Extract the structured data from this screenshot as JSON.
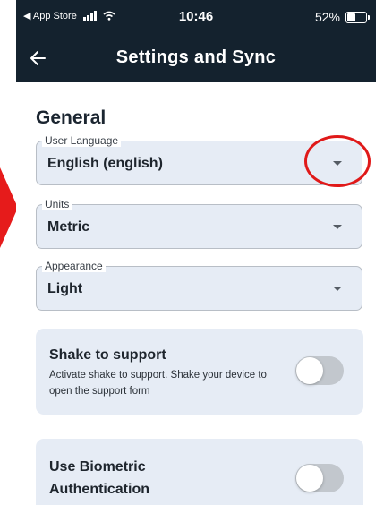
{
  "status_bar": {
    "back_app": "◀ App Store",
    "time": "10:46",
    "battery_percent": "52%",
    "battery_level": 0.52
  },
  "app_bar": {
    "title": "Settings and Sync",
    "back_icon": "arrow-left-icon"
  },
  "general": {
    "section_title": "General",
    "fields": [
      {
        "label": "User Language",
        "value": "English (english)"
      },
      {
        "label": "Units",
        "value": "Metric"
      },
      {
        "label": "Appearance",
        "value": "Light"
      }
    ]
  },
  "cards": [
    {
      "title": "Shake to support",
      "description": "Activate shake to support. Shake your device to open the support form",
      "toggle_on": false
    },
    {
      "title_line1": "Use Biometric",
      "title_line2": "Authentication",
      "toggle_on": false
    }
  ],
  "colors": {
    "header_bg": "#14222e",
    "field_bg": "#e6ecf5",
    "annotation_red": "#e01919"
  }
}
